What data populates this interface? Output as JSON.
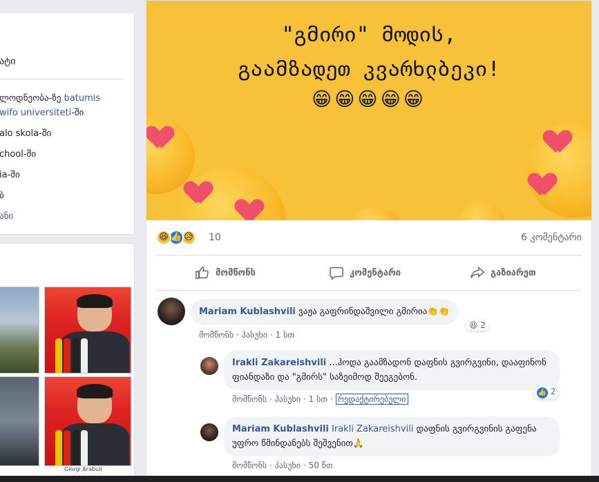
{
  "intro": {
    "heading_fragment": "ატი",
    "lines": [
      {
        "text": "ლოდნეობა-ზე ",
        "link": "batumis"
      },
      {
        "text": "",
        "link": "wifo universiteti",
        "suffix": "-ში"
      },
      {
        "text": "alo skola-ში",
        "link": ""
      },
      {
        "text": "chool-ში",
        "link": ""
      },
      {
        "text": "ia-ში",
        "link": ""
      },
      {
        "text": "ბ",
        "link": ""
      },
      {
        "text": "ანი",
        "link": "ანი"
      }
    ]
  },
  "photos": {
    "caption_fragment": "Giorgi Arabuli"
  },
  "post": {
    "banner": {
      "line1": "\"გმირი\" მოდის,",
      "line2": "გაამზადეთ კვარხლბეკი!",
      "emoji": "😁😁😁😁😁"
    },
    "reactions": {
      "icons": [
        "😆",
        "👍",
        "😥"
      ],
      "count": "10",
      "comments_label": "6 კომენტარი"
    },
    "actions": {
      "like": "მომწონს",
      "comment": "კომენტარი",
      "share": "გაზიარეთ"
    },
    "comments": [
      {
        "author": "Mariam Kublashvili",
        "text": "ვაჟა გაფრინდაშვილი გმირია👏👏",
        "meta": {
          "like": "მომწონს",
          "reply": "პასუხი",
          "time": "1 სთ"
        },
        "reaction": {
          "icon": "😆",
          "count": "2"
        }
      },
      {
        "author": "Irakli Zakareishvili",
        "text": "...ჰოდა გაამზადონ დაფნის გვირგვინი, დააფინონ ფიანდაზი და \"გმირს\" საზეიმოდ შეეგებონ.",
        "meta": {
          "like": "მომწონს",
          "reply": "პასუხი",
          "time": "1 სთ",
          "edited": "რედაქტირებული"
        },
        "reaction": {
          "icon": "👍",
          "count": "2"
        }
      },
      {
        "author": "Mariam Kublashvili",
        "mention": "Irakli Zakareishvili",
        "text": "დაფნის გვირგვინის გაფენა უფრო წმინდანებს შეშვენით🙏",
        "meta": {
          "like": "მომწონს",
          "reply": "პასუხი",
          "time": "50 წთ"
        }
      }
    ]
  },
  "colors": {
    "link": "#385898",
    "banner": "#f7c23a",
    "like_blue": "#1877f2"
  }
}
